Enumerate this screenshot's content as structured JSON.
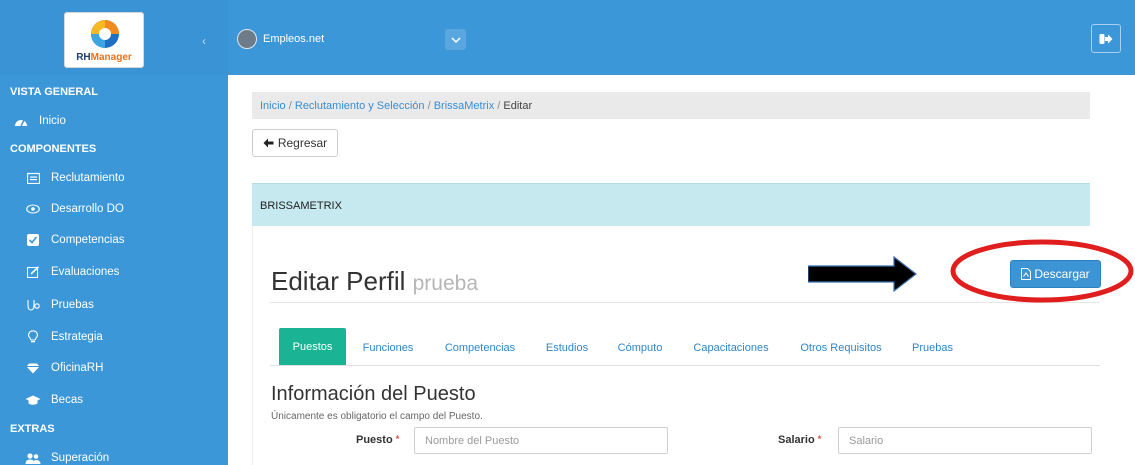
{
  "app": {
    "logo_text_primary": "RH",
    "logo_text_accent": "Manager",
    "brand_name": "Empleos.net",
    "colors": {
      "sidebar": "#3c97d9",
      "tab_active": "#1ab394",
      "panel_header": "#c5e9ef",
      "download_button": "#3c94d4",
      "annotation_circle": "#e01e1e"
    }
  },
  "sidebar": {
    "section_general": "VISTA GENERAL",
    "section_components": "COMPONENTES",
    "section_extras": "EXTRAS",
    "items": [
      {
        "label": "Inicio",
        "icon": "dashboard-icon"
      },
      {
        "label": "Reclutamiento",
        "icon": "folder-icon"
      },
      {
        "label": "Desarrollo DO",
        "icon": "eye-icon"
      },
      {
        "label": "Competencias",
        "icon": "check-square-icon"
      },
      {
        "label": "Evaluaciones",
        "icon": "edit-icon"
      },
      {
        "label": "Pruebas",
        "icon": "flask-icon"
      },
      {
        "label": "Estrategia",
        "icon": "lightbulb-icon"
      },
      {
        "label": "OficinaRH",
        "icon": "diamond-icon"
      },
      {
        "label": "Becas",
        "icon": "graduation-cap-icon"
      },
      {
        "label": "Superación",
        "icon": "users-icon"
      }
    ]
  },
  "breadcrumb": {
    "items": [
      "Inicio",
      "Reclutamiento y Selección",
      "BrissaMetrix"
    ],
    "current": "Editar",
    "separator": "/"
  },
  "back_button": {
    "label": "Regresar"
  },
  "panel": {
    "header": "BRISSAMETRIX"
  },
  "page": {
    "title": "Editar Perfil",
    "subtitle": "prueba",
    "download_label": "Descargar"
  },
  "tabs": [
    {
      "label": "Puestos",
      "active": true
    },
    {
      "label": "Funciones",
      "active": false
    },
    {
      "label": "Competencias",
      "active": false
    },
    {
      "label": "Estudios",
      "active": false
    },
    {
      "label": "Cómputo",
      "active": false
    },
    {
      "label": "Capacitaciones",
      "active": false
    },
    {
      "label": "Otros Requisitos",
      "active": false
    },
    {
      "label": "Pruebas",
      "active": false
    }
  ],
  "form": {
    "section_title": "Información del Puesto",
    "section_note": "Únicamente es obligatorio el campo del Puesto.",
    "required_mark": "*",
    "puesto": {
      "label": "Puesto",
      "value": "",
      "placeholder": "Nombre del Puesto"
    },
    "salario": {
      "label": "Salario",
      "value": "",
      "placeholder": "Salario"
    }
  }
}
